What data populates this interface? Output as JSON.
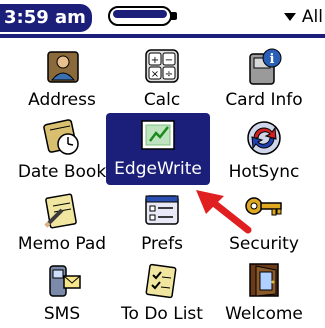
{
  "status": {
    "time": "3:59 am",
    "category": "All"
  },
  "apps": [
    {
      "label": "Address",
      "icon": "address-icon"
    },
    {
      "label": "Calc",
      "icon": "calc-icon"
    },
    {
      "label": "Card Info",
      "icon": "card-info-icon"
    },
    {
      "label": "Date Book",
      "icon": "date-book-icon"
    },
    {
      "label": "EdgeWrite",
      "icon": "edgewrite-icon"
    },
    {
      "label": "HotSync",
      "icon": "hotsync-icon"
    },
    {
      "label": "Memo Pad",
      "icon": "memo-pad-icon"
    },
    {
      "label": "Prefs",
      "icon": "prefs-icon"
    },
    {
      "label": "Security",
      "icon": "security-icon"
    },
    {
      "label": "SMS",
      "icon": "sms-icon"
    },
    {
      "label": "To Do List",
      "icon": "to-do-list-icon"
    },
    {
      "label": "Welcome",
      "icon": "welcome-icon"
    }
  ],
  "colors": {
    "accent": "#1b1f7a",
    "arrow": "#e02020"
  }
}
